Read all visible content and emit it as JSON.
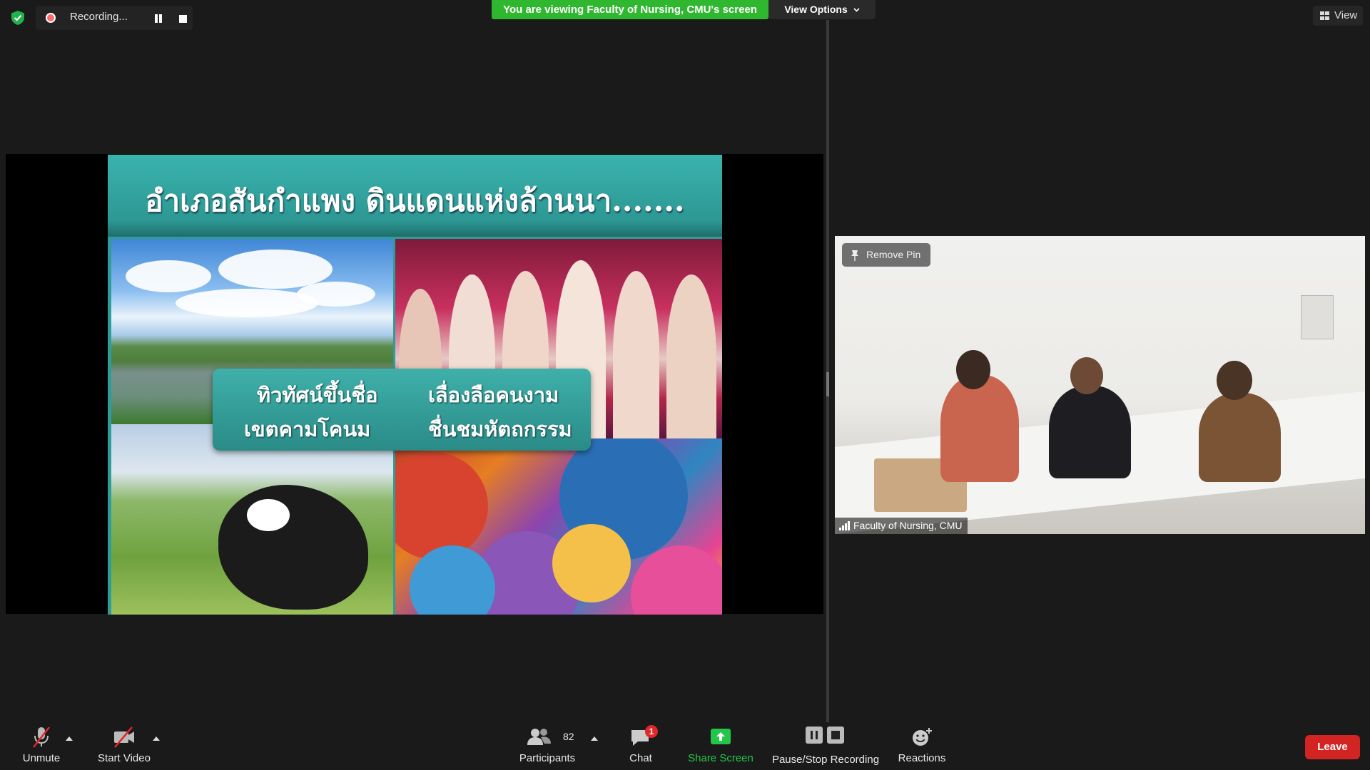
{
  "recording": {
    "label": "Recording..."
  },
  "screen_share": {
    "banner": "You are viewing Faculty of Nursing, CMU's screen",
    "view_options": "View Options"
  },
  "view_button": "View",
  "slide": {
    "title": "อำเภอสันกำแพง  ดินแดนแห่งล้านนา.......",
    "captions": [
      "ทิวทัศน์ขึ้นชื่อ",
      "เขตคามโคนม",
      "เลื่องลือคนงาม",
      "ชื่นชมหัตถกรรม"
    ]
  },
  "video": {
    "remove_pin": "Remove Pin",
    "participant_name": "Faculty of Nursing, CMU"
  },
  "toolbar": {
    "unmute": "Unmute",
    "start_video": "Start Video",
    "participants": "Participants",
    "participants_count": "82",
    "chat": "Chat",
    "chat_badge": "1",
    "share_screen": "Share Screen",
    "pause_stop_recording": "Pause/Stop Recording",
    "reactions": "Reactions",
    "leave": "Leave"
  },
  "colors": {
    "banner_green": "#2fb82f",
    "share_green": "#23c64a",
    "leave_red": "#d32424",
    "slide_teal": "#2f9c99"
  },
  "icons": [
    "shield-check-icon",
    "record-icon",
    "pause-icon",
    "stop-icon",
    "chevron-down-icon",
    "grid-view-icon",
    "pin-icon",
    "signal-icon",
    "microphone-muted-icon",
    "video-camera-muted-icon",
    "participants-icon",
    "chat-icon",
    "share-screen-icon",
    "reactions-icon"
  ]
}
